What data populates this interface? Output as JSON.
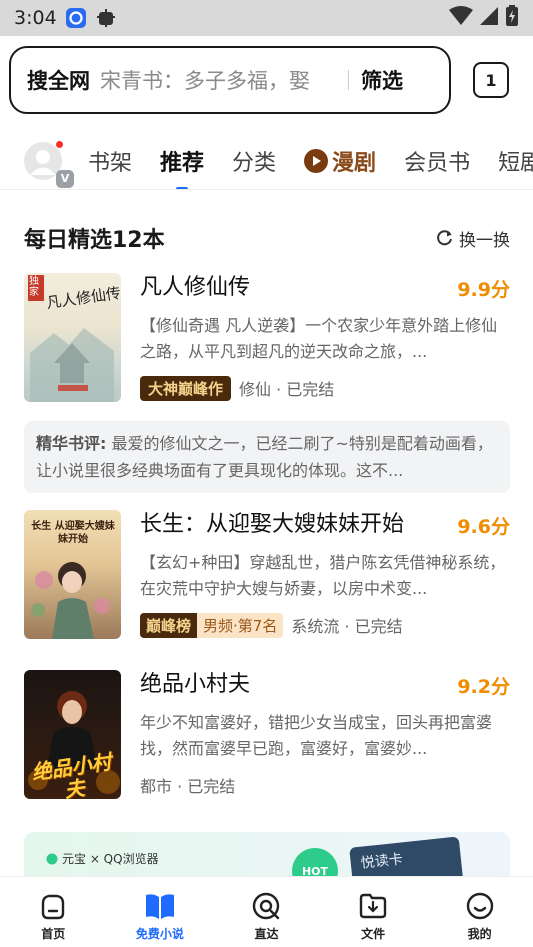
{
  "status_bar": {
    "time": "3:04"
  },
  "search": {
    "scope_label": "搜全网",
    "placeholder": "宋青书：多子多福，娶",
    "filter_label": "筛选",
    "tab_count": "1"
  },
  "nav_tabs": {
    "items": [
      "书架",
      "推荐",
      "分类",
      "漫剧",
      "会员书",
      "短剧"
    ],
    "active": "推荐"
  },
  "section": {
    "title": "每日精选12本",
    "refresh_label": "换一换"
  },
  "books": [
    {
      "title": "凡人修仙传",
      "score": "9.9分",
      "desc": "【修仙奇遇 凡人逆袭】一个农家少年意外踏上修仙之路，从平凡到超凡的逆天改命之旅，...",
      "badge": "大神巅峰作",
      "meta": "修仙 · 已完结",
      "cover_title": "凡人修仙传",
      "cover_tag": "独家"
    },
    {
      "title": "长生：从迎娶大嫂妹妹开始",
      "score": "9.6分",
      "desc": "【玄幻+种田】穿越乱世，猎户陈玄凭借神秘系统，在灾荒中守护大嫂与娇妻，以房中术变...",
      "badge_a": "巅峰榜",
      "badge_b": "男频·第7名",
      "meta": "系统流 · 已完结",
      "cover_title": "长生 从迎娶大嫂妹妹开始"
    },
    {
      "title": "绝品小村夫",
      "score": "9.2分",
      "desc": "年少不知富婆好，错把少女当成宝，回头再把富婆找，然而富婆早已跑，富婆好，富婆妙...",
      "meta": "都市 · 已完结",
      "cover_title": "绝品小村夫"
    }
  ],
  "comment": {
    "label": "精华书评:",
    "text": " 最爱的修仙文之一，已经二刷了~特别是配着动画看，让小说里很多经典场面有了更具现化的体现。这不..."
  },
  "banner": {
    "brand": "元宝 × QQ浏览器",
    "hot": "HOT",
    "card_text": "悦读卡"
  },
  "bottom_nav": {
    "items": [
      "首页",
      "免费小说",
      "直达",
      "文件",
      "我的"
    ],
    "active": "免费小说"
  },
  "colors": {
    "accent": "#1f6bff",
    "score": "#f08c00",
    "drama": "#8a4a1a"
  }
}
